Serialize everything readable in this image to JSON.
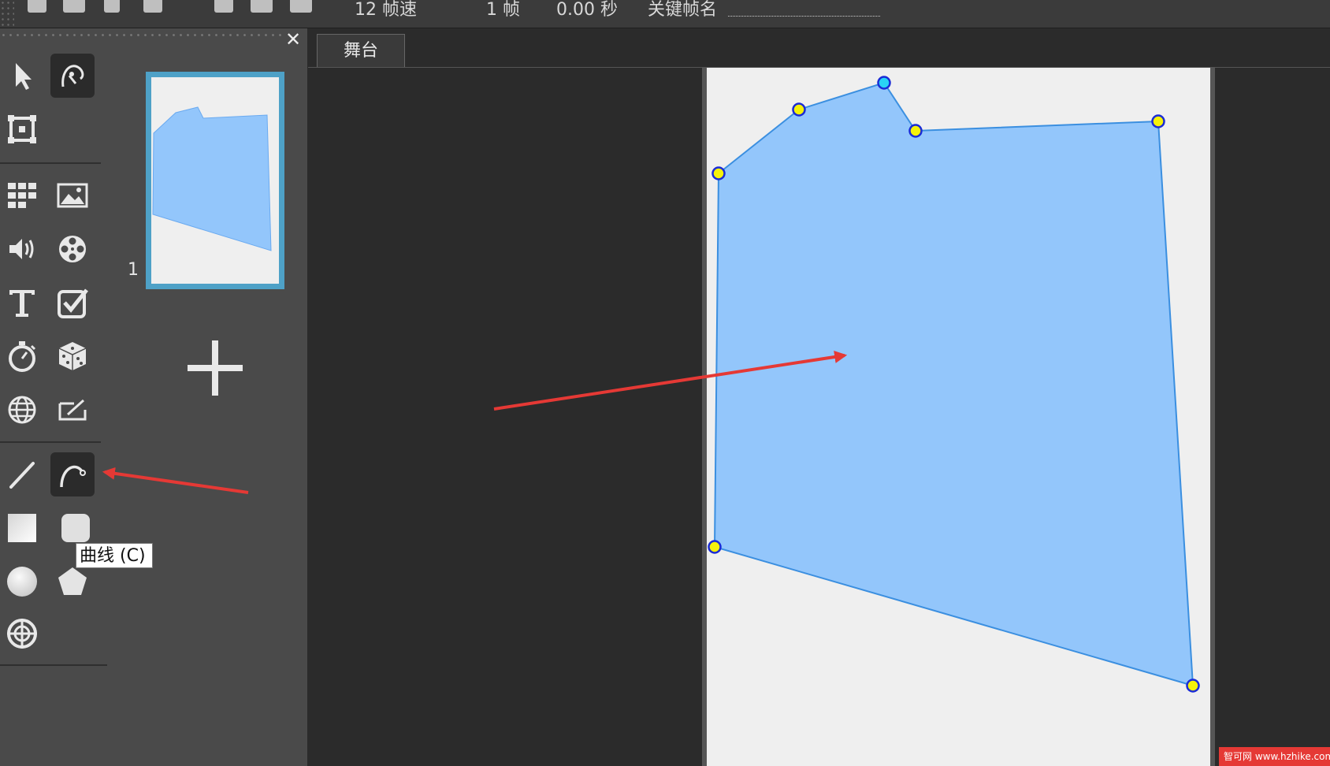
{
  "toolbar": {
    "fps_label": "12 帧速",
    "frame_label": "1 帧",
    "time_label": "0.00 秒",
    "keyframe_label": "关键帧名"
  },
  "panel": {
    "close_glyph": "✕",
    "tools": [
      {
        "name": "select-tool"
      },
      {
        "name": "node-edit-tool",
        "active": true
      },
      {
        "name": "transform-tool"
      },
      {
        "name": "grid-tool"
      },
      {
        "name": "image-tool"
      },
      {
        "name": "sound-tool"
      },
      {
        "name": "video-tool"
      },
      {
        "name": "text-tool"
      },
      {
        "name": "checkbox-tool"
      },
      {
        "name": "timer-tool"
      },
      {
        "name": "dice-tool"
      },
      {
        "name": "web-tool"
      },
      {
        "name": "input-tool"
      },
      {
        "name": "line-tool"
      },
      {
        "name": "curve-tool",
        "active": true
      },
      {
        "name": "rectangle-tool"
      },
      {
        "name": "rounded-rect-tool"
      },
      {
        "name": "circle-tool"
      },
      {
        "name": "polygon-tool"
      },
      {
        "name": "target-tool"
      }
    ],
    "tooltip": "曲线 (C)"
  },
  "frames": {
    "items": [
      {
        "number": "1"
      }
    ]
  },
  "stage": {
    "tab_label": "舞台",
    "shape_fill": "#93c6fb",
    "shape_stroke": "#3b8fe0",
    "vertex_fill": "#f6f20a",
    "selected_vertex_fill": "#29d3f5",
    "annotation_color": "#e53935"
  },
  "watermark": "智可网 www.hzhike.com"
}
